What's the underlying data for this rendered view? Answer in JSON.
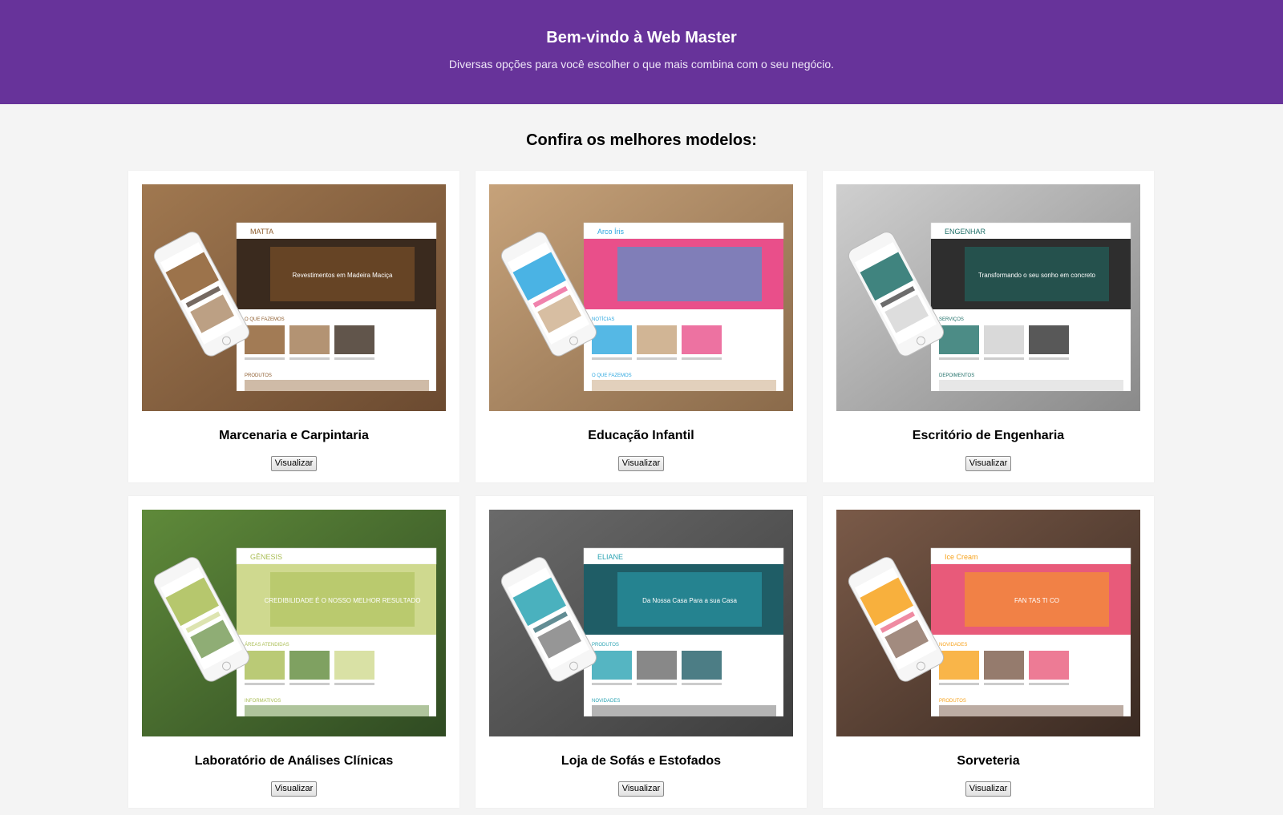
{
  "header": {
    "title": "Bem-vindo à Web Master",
    "subtitle": "Diversas opções para você escolher o que mais combina com o seu negócio."
  },
  "main": {
    "section_title": "Confira os melhores modelos:",
    "cards": [
      {
        "title": "Marcenaria e Carpintaria",
        "button_label": "Visualizar",
        "preview": {
          "brand": "MATTA",
          "headline": "Revestimentos em Madeira Maciça",
          "section_label": "O QUE FAZEMOS",
          "section_label_2": "PRODUTOS",
          "colors": {
            "bg": "#6b4a30",
            "bg2": "#a07850",
            "accent": "#8b5a2b",
            "panel": "#3a2a1e"
          }
        }
      },
      {
        "title": "Educação Infantil",
        "button_label": "Visualizar",
        "preview": {
          "brand": "Arco Íris",
          "headline": "",
          "section_label": "NOTÍCIAS",
          "section_label_2": "O QUE FAZEMOS",
          "colors": {
            "bg": "#8a6a4a",
            "bg2": "#c6a27a",
            "accent": "#2aa6df",
            "panel": "#e94f8a"
          }
        }
      },
      {
        "title": "Escritório de Engenharia",
        "button_label": "Visualizar",
        "preview": {
          "brand": "ENGENHAR",
          "headline": "Transformando o seu sonho em concreto",
          "section_label": "SERVIÇOS",
          "section_label_2": "DEPOIMENTOS",
          "colors": {
            "bg": "#8a8a8a",
            "bg2": "#cfcfcf",
            "accent": "#1f6f68",
            "panel": "#2e2e2e"
          }
        }
      },
      {
        "title": "Laboratório de Análises Clínicas",
        "button_label": "Visualizar",
        "preview": {
          "brand": "GÊNESIS",
          "headline": "CREDIBILIDADE É O NOSSO MELHOR RESULTADO",
          "section_label": "ÁREAS ATENDIDAS",
          "section_label_2": "INFORMATIVOS",
          "colors": {
            "bg": "#2f4a22",
            "bg2": "#5f8a3a",
            "accent": "#a9bd54",
            "panel": "#cfd98f"
          }
        }
      },
      {
        "title": "Loja de Sofás e Estofados",
        "button_label": "Visualizar",
        "preview": {
          "brand": "ELIANE",
          "headline": "Da Nossa Casa Para a sua Casa",
          "section_label": "PRODUTOS",
          "section_label_2": "NOVIDADES",
          "colors": {
            "bg": "#3d3d3d",
            "bg2": "#6a6a6a",
            "accent": "#2aa3b3",
            "panel": "#1f5d66"
          }
        }
      },
      {
        "title": "Sorveteria",
        "button_label": "Visualizar",
        "preview": {
          "brand": "Ice Cream",
          "headline": "FAN TAS TI CO",
          "section_label": "NOVIDADES",
          "section_label_2": "PRODUTOS",
          "colors": {
            "bg": "#3a2a22",
            "bg2": "#7a5a48",
            "accent": "#f7a21b",
            "panel": "#e85a7a"
          }
        }
      }
    ]
  }
}
